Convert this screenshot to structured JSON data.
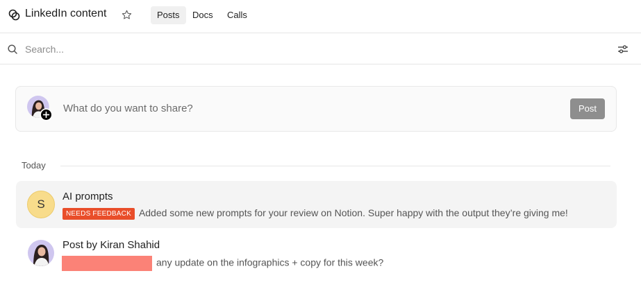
{
  "header": {
    "title": "LinkedIn content",
    "tabs": [
      {
        "label": "Posts",
        "active": true
      },
      {
        "label": "Docs",
        "active": false
      },
      {
        "label": "Calls",
        "active": false
      }
    ]
  },
  "search": {
    "placeholder": "Search..."
  },
  "composer": {
    "placeholder": "What do you want to share?",
    "post_label": "Post"
  },
  "feed": {
    "section_label": "Today",
    "items": [
      {
        "avatar_letter": "S",
        "title": "AI prompts",
        "badge": "NEEDS FEEDBACK",
        "text": "Added some new prompts for your review on Notion. Super happy with the output they’re giving me!"
      },
      {
        "title": "Post by Kiran Shahid",
        "text": "any update on the infographics + copy for this week?"
      }
    ]
  },
  "colors": {
    "badge": "#e94e2a",
    "redaction": "#fb8277",
    "letter_avatar": "#f8dc8b",
    "post_button": "#8e8e8e"
  }
}
